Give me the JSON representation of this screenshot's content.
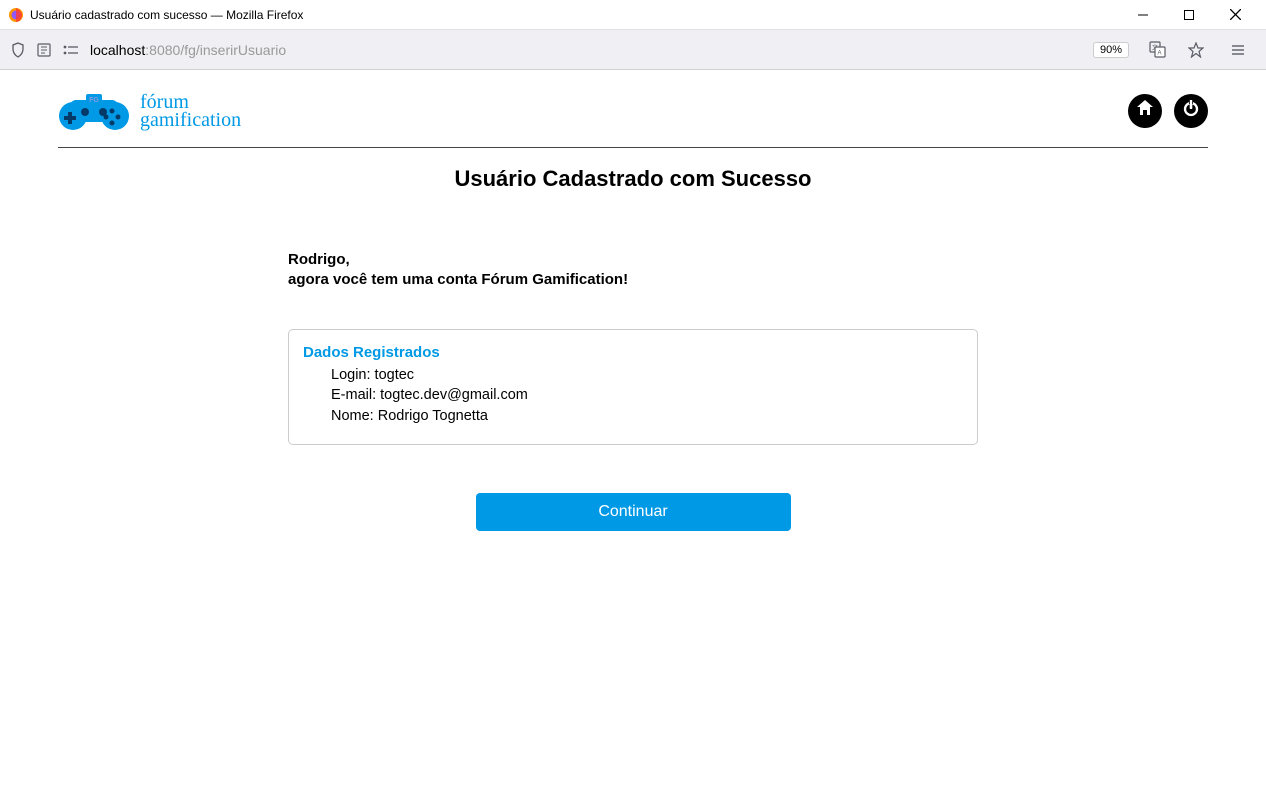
{
  "window": {
    "title": "Usuário cadastrado com sucesso — Mozilla Firefox"
  },
  "addressbar": {
    "url_prefix": "localhost",
    "url_port": ":8080",
    "url_path": "/fg/inserirUsuario",
    "zoom": "90%"
  },
  "logo": {
    "line1": "fórum",
    "line2": "gamification"
  },
  "page": {
    "title": "Usuário Cadastrado com Sucesso",
    "greeting_name": "Rodrigo,",
    "greeting_line2": "agora você tem uma conta Fórum Gamification!",
    "box_title": "Dados Registrados",
    "login_label": "Login: ",
    "login_value": "togtec",
    "email_label": "E-mail: ",
    "email_value": "togtec.dev@gmail.com",
    "nome_label": "Nome: ",
    "nome_value": "Rodrigo Tognetta",
    "continue_label": "Continuar"
  }
}
